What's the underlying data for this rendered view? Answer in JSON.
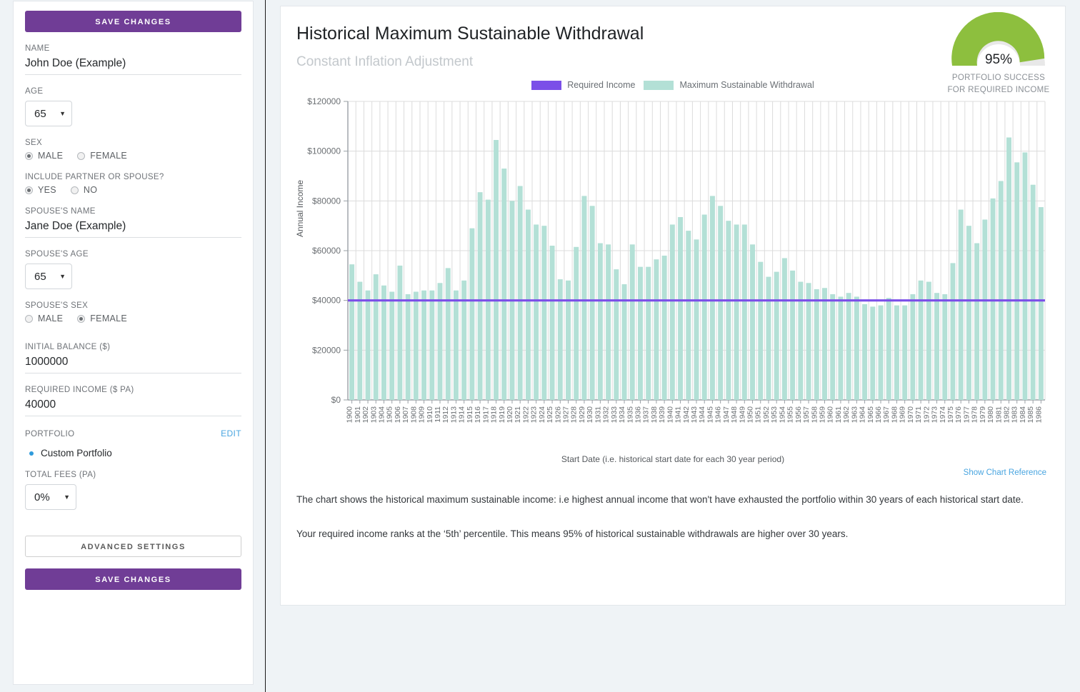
{
  "sidebar": {
    "save_top_label": "SAVE CHANGES",
    "save_bottom_label": "SAVE CHANGES",
    "advanced_label": "ADVANCED SETTINGS",
    "name": {
      "label": "NAME",
      "value": "John Doe (Example)"
    },
    "age": {
      "label": "AGE",
      "value": "65"
    },
    "sex": {
      "label": "SEX",
      "male": "MALE",
      "female": "FEMALE",
      "selected": "MALE"
    },
    "include_partner": {
      "label": "INCLUDE PARTNER OR SPOUSE?",
      "yes": "YES",
      "no": "NO",
      "selected": "YES"
    },
    "spouse_name": {
      "label": "SPOUSE'S NAME",
      "value": "Jane Doe (Example)"
    },
    "spouse_age": {
      "label": "SPOUSE'S AGE",
      "value": "65"
    },
    "spouse_sex": {
      "label": "SPOUSE'S SEX",
      "male": "MALE",
      "female": "FEMALE",
      "selected": "FEMALE"
    },
    "initial_balance": {
      "label": "INITIAL BALANCE ($)",
      "value": "1000000"
    },
    "required_income": {
      "label": "REQUIRED INCOME ($ PA)",
      "value": "40000"
    },
    "portfolio": {
      "label": "PORTFOLIO",
      "edit": "EDIT",
      "selected_name": "Custom Portfolio"
    },
    "total_fees": {
      "label": "TOTAL FEES (PA)",
      "value": "0%"
    }
  },
  "main": {
    "title": "Historical Maximum Sustainable Withdrawal",
    "subtitle": "Constant Inflation Adjustment",
    "gauge": {
      "value_text": "95%",
      "percent": 95,
      "caption_line1": "PORTFOLIO SUCCESS",
      "caption_line2": "FOR REQUIRED INCOME",
      "fill_color": "#8dbf3e",
      "track_color": "#e8e8e8"
    },
    "show_chart_reference": "Show Chart Reference",
    "paragraph1": "The chart shows the historical maximum sustainable income: i.e highest annual income that won't have exhausted the portfolio within 30 years of each historical start date.",
    "paragraph2": "Your required income ranks at the ‘5th’ percentile. This means 95% of historical sustainable withdrawals are higher over 30 years."
  },
  "chart_data": {
    "type": "bar",
    "title": "Historical Maximum Sustainable Withdrawal",
    "subtitle": "Constant Inflation Adjustment",
    "xlabel": "Start Date (i.e. historical start date for each 30 year period)",
    "ylabel": "Annual Income",
    "ylim": [
      0,
      120000
    ],
    "ytick_labels": [
      "$0",
      "$20000",
      "$40000",
      "$60000",
      "$80000",
      "$100000",
      "$120000"
    ],
    "yticks": [
      0,
      20000,
      40000,
      60000,
      80000,
      100000,
      120000
    ],
    "grid": true,
    "legend_position": "top-center",
    "legend": [
      {
        "name": "Required Income",
        "color": "#7b4fe8",
        "kind": "line"
      },
      {
        "name": "Maximum Sustainable Withdrawal",
        "color": "#b3e0d6",
        "kind": "bar"
      }
    ],
    "reference_line": {
      "name": "Required Income",
      "value": 40000,
      "color": "#7b4fe8"
    },
    "categories": [
      "1900",
      "1901",
      "1902",
      "1903",
      "1904",
      "1905",
      "1906",
      "1907",
      "1908",
      "1909",
      "1910",
      "1911",
      "1912",
      "1913",
      "1914",
      "1915",
      "1916",
      "1917",
      "1918",
      "1919",
      "1920",
      "1921",
      "1922",
      "1923",
      "1924",
      "1925",
      "1926",
      "1927",
      "1928",
      "1929",
      "1930",
      "1931",
      "1932",
      "1933",
      "1934",
      "1935",
      "1936",
      "1937",
      "1938",
      "1939",
      "1940",
      "1941",
      "1942",
      "1943",
      "1944",
      "1945",
      "1946",
      "1947",
      "1948",
      "1949",
      "1950",
      "1951",
      "1952",
      "1953",
      "1954",
      "1955",
      "1956",
      "1957",
      "1958",
      "1959",
      "1960",
      "1961",
      "1962",
      "1963",
      "1964",
      "1965",
      "1966",
      "1967",
      "1968",
      "1969",
      "1970",
      "1971",
      "1972",
      "1973",
      "1974",
      "1975",
      "1976",
      "1977",
      "1978",
      "1979",
      "1980",
      "1981",
      "1982",
      "1983",
      "1984",
      "1985",
      "1986"
    ],
    "series": [
      {
        "name": "Maximum Sustainable Withdrawal",
        "color": "#b3e0d6",
        "values": [
          54500,
          47500,
          44000,
          50500,
          46000,
          43500,
          54000,
          42500,
          43500,
          44000,
          44000,
          47000,
          53000,
          44000,
          48000,
          69000,
          83500,
          80500,
          104500,
          93000,
          80000,
          86000,
          76500,
          70500,
          70000,
          62000,
          48500,
          48000,
          61500,
          82000,
          78000,
          63000,
          62500,
          52500,
          46500,
          62500,
          53500,
          53500,
          56500,
          58000,
          70500,
          73500,
          68000,
          64500,
          74500,
          82000,
          78000,
          72000,
          70500,
          70500,
          62500,
          55500,
          49500,
          51500,
          57000,
          52000,
          47500,
          47000,
          44500,
          45000,
          42500,
          41500,
          43000,
          41500,
          38500,
          37500,
          38000,
          41000,
          38000,
          38000,
          42500,
          48000,
          47500,
          43000,
          42500,
          55000,
          76500,
          70000,
          63000,
          72500,
          81000,
          88000,
          105500,
          95500,
          99500,
          86500,
          77500
        ]
      }
    ]
  }
}
